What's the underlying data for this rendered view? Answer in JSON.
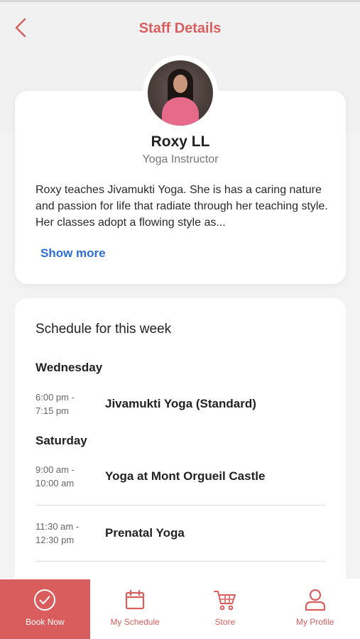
{
  "header": {
    "title": "Staff Details",
    "back_icon": "chevron-left-icon"
  },
  "staff": {
    "name": "Roxy LL",
    "role": "Yoga Instructor",
    "bio": "Roxy teaches Jivamukti Yoga. She is has a caring nature and passion for life that radiate through her teaching style.  Her classes adopt a flowing style as...",
    "show_more_label": "Show more"
  },
  "schedule": {
    "title": "Schedule for this week",
    "days": [
      {
        "day": "Wednesday",
        "classes": [
          {
            "start": "6:00 pm -",
            "end": "7:15 pm",
            "name": "Jivamukti Yoga (Standard)"
          }
        ]
      },
      {
        "day": "Saturday",
        "classes": [
          {
            "start": "9:00 am -",
            "end": "10:00 am",
            "name": "Yoga at Mont Orgueil Castle"
          },
          {
            "start": "11:30 am -",
            "end": "12:30 pm",
            "name": "Prenatal Yoga"
          }
        ]
      }
    ]
  },
  "bottom_nav": {
    "items": [
      {
        "label": "Book Now",
        "icon": "check-circle-icon",
        "active": true
      },
      {
        "label": "My Schedule",
        "icon": "calendar-icon",
        "active": false
      },
      {
        "label": "Store",
        "icon": "cart-icon",
        "active": false
      },
      {
        "label": "My Profile",
        "icon": "user-icon",
        "active": false
      }
    ]
  },
  "colors": {
    "accent": "#d95f5f",
    "link": "#2f6fd1",
    "background": "#f1f1f1"
  }
}
